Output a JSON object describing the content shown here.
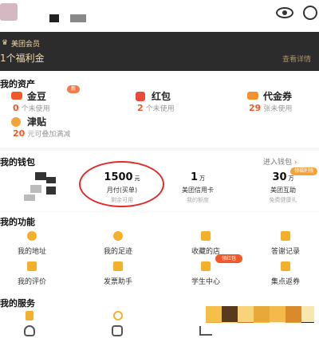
{
  "member": {
    "title": "美团会员",
    "benefit": "1个福利金",
    "more": "查看详情"
  },
  "assets": {
    "title": "我的资产",
    "new_badge": "新",
    "items": [
      {
        "icon": "gold-bean-icon",
        "name": "金豆",
        "count": "0",
        "note": "个未使用"
      },
      {
        "icon": "red-packet-icon",
        "name": "红包",
        "count": "2",
        "note": "个未使用"
      },
      {
        "icon": "voucher-icon",
        "name": "代金券",
        "count": "29",
        "note": "张未使用"
      },
      {
        "icon": "subsidy-icon",
        "name": "津贴",
        "count": "20",
        "note": "元可叠加满减"
      }
    ]
  },
  "wallet": {
    "title": "我的钱包",
    "entry": "进入钱包",
    "hot_tag": "领福利钱",
    "items": [
      {
        "value": "1500",
        "unit": "元",
        "label": "月付(买单)",
        "sub": "剩余可用"
      },
      {
        "value": "1",
        "unit": "万",
        "label": "美团信用卡",
        "sub": "我的额度"
      },
      {
        "value": "30",
        "unit": "万",
        "label": "美团互助",
        "sub": "免费健康礼"
      }
    ]
  },
  "functions": {
    "title": "我的功能",
    "lead_badge": "领红包",
    "items": [
      {
        "icon": "address-icon",
        "label": "我的地址"
      },
      {
        "icon": "footprint-icon",
        "label": "我的足迹"
      },
      {
        "icon": "star-icon",
        "label": "收藏的店"
      },
      {
        "icon": "record-icon",
        "label": "答谢记录"
      },
      {
        "icon": "review-icon",
        "label": "我的评价"
      },
      {
        "icon": "invoice-icon",
        "label": "发票助手"
      },
      {
        "icon": "student-icon",
        "label": "学生中心"
      },
      {
        "icon": "points-icon",
        "label": "集点返券"
      }
    ]
  },
  "services": {
    "title": "我的服务"
  },
  "colors": {
    "accent": "#f0592a",
    "gold": "#f5b02b",
    "banner_bg": "#2c2c2c",
    "circle": "#e32b2b"
  }
}
